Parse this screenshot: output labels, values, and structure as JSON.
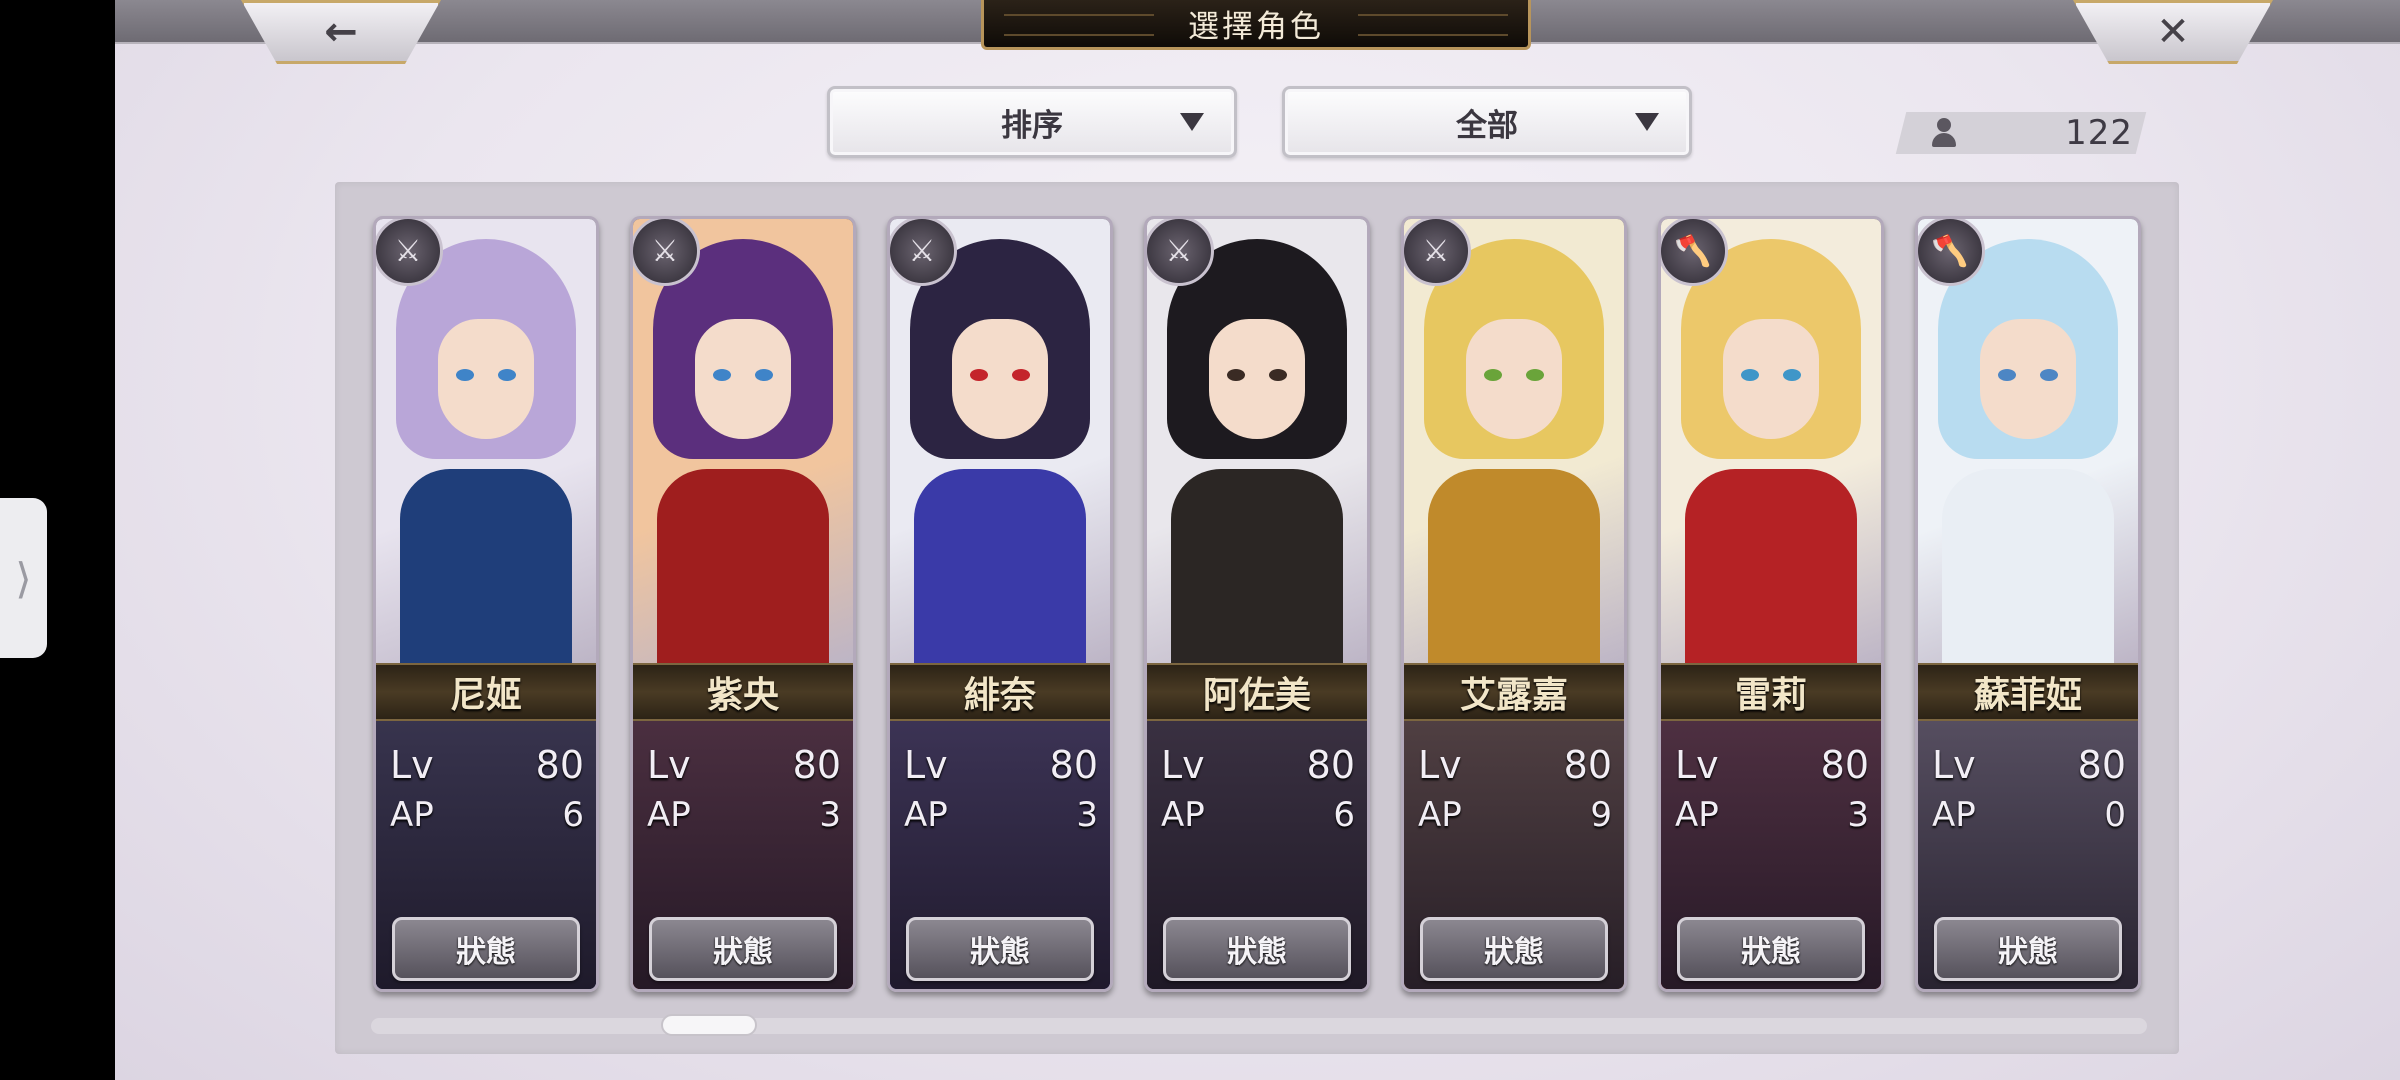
{
  "header": {
    "title": "選擇角色",
    "back_icon": "←",
    "close_icon": "✕"
  },
  "filters": {
    "sort_label": "排序",
    "category_label": "全部"
  },
  "roster": {
    "count": "122"
  },
  "labels": {
    "lv": "Lv",
    "ap": "AP",
    "status": "狀態"
  },
  "characters": [
    {
      "name": "尼姬",
      "lv": "80",
      "ap": "6",
      "weapon_icon": "sword-icon",
      "colors": {
        "bg": "#e8e4ef",
        "hair": "#b9a6d8",
        "body": "#1f3e7a",
        "eye": "#3f84c8"
      }
    },
    {
      "name": "紫央",
      "lv": "80",
      "ap": "3",
      "weapon_icon": "sword-icon",
      "colors": {
        "bg": "#f1c59e",
        "hair": "#5b2f7d",
        "body": "#9f1e1e",
        "eye": "#3f84c8"
      }
    },
    {
      "name": "緋奈",
      "lv": "80",
      "ap": "3",
      "weapon_icon": "sword-icon",
      "colors": {
        "bg": "#eaeaf2",
        "hair": "#2c2442",
        "body": "#3a3aa8",
        "eye": "#c4242b"
      }
    },
    {
      "name": "阿佐美",
      "lv": "80",
      "ap": "6",
      "weapon_icon": "sword-icon",
      "colors": {
        "bg": "#e9e7ec",
        "hair": "#1d1a1f",
        "body": "#2b2624",
        "eye": "#3a2b24"
      }
    },
    {
      "name": "艾露嘉",
      "lv": "80",
      "ap": "9",
      "weapon_icon": "sword-icon",
      "colors": {
        "bg": "#f2ead2",
        "hair": "#e7c760",
        "body": "#c08a2b",
        "eye": "#6aa43a"
      }
    },
    {
      "name": "雷莉",
      "lv": "80",
      "ap": "3",
      "weapon_icon": "axe-icon",
      "colors": {
        "bg": "#f3ecdc",
        "hair": "#ecc86a",
        "body": "#b52225",
        "eye": "#3f96c8"
      }
    },
    {
      "name": "蘇菲婭",
      "lv": "80",
      "ap": "0",
      "weapon_icon": "axe-icon",
      "colors": {
        "bg": "#eef2f7",
        "hair": "#b8dcf0",
        "body": "#e9eef4",
        "eye": "#4d86c4"
      }
    }
  ]
}
